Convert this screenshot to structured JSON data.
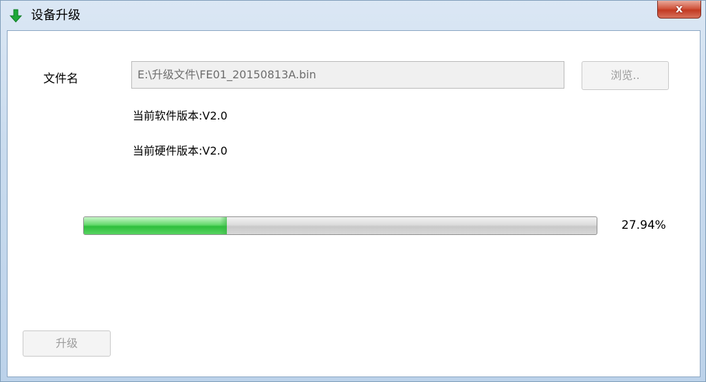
{
  "window": {
    "title": "设备升级",
    "title_icon": "green-down-arrow-icon",
    "close_icon": "close-x-icon",
    "close_label": "x"
  },
  "form": {
    "file_label": "文件名",
    "file_path": "E:\\升级文件\\FE01_20150813A.bin",
    "browse_label": "浏览..",
    "software_version": "当前软件版本:V2.0",
    "hardware_version": "当前硬件版本:V2.0"
  },
  "progress": {
    "fraction": 0.2794,
    "percent_text": "27.94%",
    "fill_color": "#34c142"
  },
  "actions": {
    "upgrade_label": "升级"
  }
}
